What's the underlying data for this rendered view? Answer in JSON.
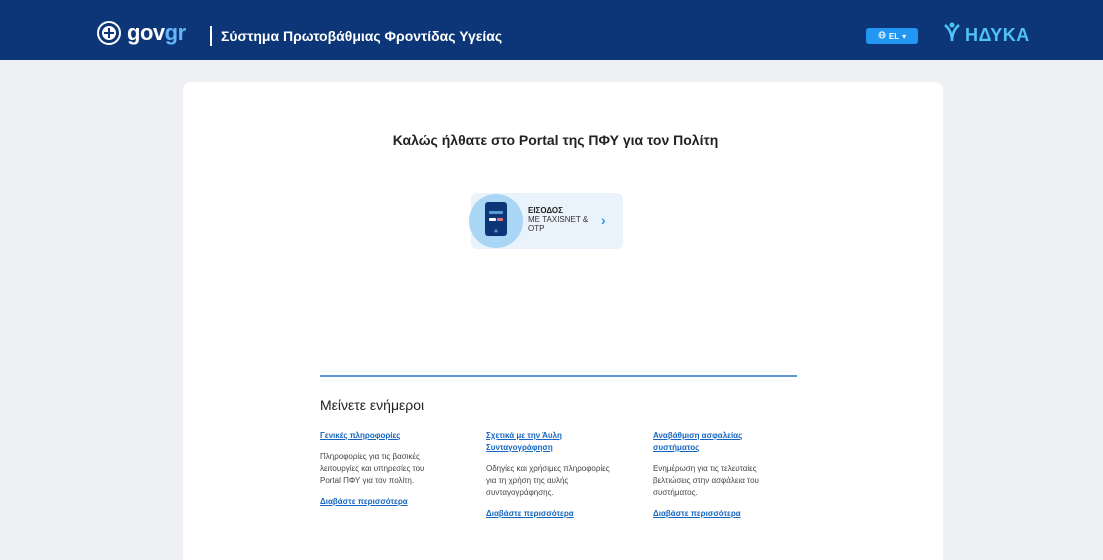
{
  "header": {
    "gov_logo_main": "gov",
    "gov_logo_accent": "gr",
    "system_title": "Σύστημα Πρωτοβάθμιας Φροντίδας Υγείας",
    "language": "EL",
    "hdyka_logo": "ΗΔΥΚΑ"
  },
  "main": {
    "welcome": "Καλώς ήλθατε στο Portal της ΠΦΥ για τον Πολίτη",
    "login": {
      "line1": "ΕΙΣΟΔΟΣ",
      "line2": "ΜΕ TAXISNET &",
      "line3": "OTP"
    },
    "stay_informed": "Μείνετε ενήμεροι",
    "columns": [
      {
        "title": "Γενικές πληροφορίες",
        "description": "Πληροφορίες για τις βασικές λειτουργίες και υπηρεσίες του Portal ΠΦΥ για τον πολίτη.",
        "link": "Διαβάστε περισσότερα"
      },
      {
        "title": "Σχετικά με την Άυλη Συνταγογράφηση",
        "description": "Οδηγίες και χρήσιμες πληροφορίες για τη χρήση της αυλής συνταγογράφησης.",
        "link": "Διαβάστε περισσότερα"
      },
      {
        "title": "Αναβάθμιση ασφαλείας συστήματος",
        "description": "Ενημέρωση για τις τελευταίες βελτιώσεις στην ασφάλεια του συστήματος.",
        "link": "Διαβάστε περισσότερα"
      }
    ]
  },
  "colors": {
    "header_bg": "#0c3677",
    "accent_blue": "#2196f3",
    "link_blue": "#1565c0",
    "page_bg": "#eef0f4"
  }
}
